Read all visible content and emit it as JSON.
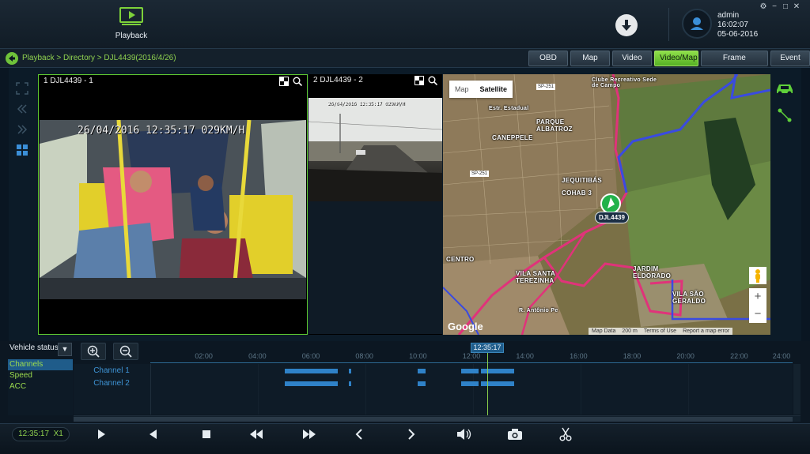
{
  "app": {
    "module_label": "Playback",
    "user": {
      "name": "admin",
      "time": "16:02:07",
      "date": "05-06-2016"
    },
    "window_controls": [
      "⚙",
      "−",
      "□",
      "✕"
    ]
  },
  "breadcrumb": "Playback > Directory > DJL4439(2016/4/26)",
  "view_tabs": [
    "OBD",
    "Map",
    "Video",
    "Video/Map",
    "Frame Information",
    "Event"
  ],
  "active_view_tab": "Video/Map",
  "panes": [
    {
      "title": "1 DJL4439 - 1",
      "osd": "26/04/2016 12:35:17  029KM/H"
    },
    {
      "title": "2 DJL4439 - 2",
      "osd": "26/04/2016 12:35:17  029KM/H"
    }
  ],
  "map": {
    "type_options": [
      "Map",
      "Satellite"
    ],
    "active_type": "Satellite",
    "vehicle_label": "DJL4439",
    "place_labels": [
      "PARQUE ALBATROZ",
      "CANEPPELE",
      "JEQUITIBÁS",
      "COHAB 3",
      "CENTRO",
      "VILA SANTA TEREZINHA",
      "JARDIM ELDORADO",
      "VILA SÃO GERALDO",
      "Clube Recreativo Sede de Campo",
      "Estr. Estadual",
      "R. Antônio Pe"
    ],
    "road_chips": [
      "SP-251",
      "SP-251"
    ],
    "footer": [
      "Map Data",
      "200 m",
      "Terms of Use",
      "Report a map error"
    ],
    "google_logo": "Google",
    "zoom_in": "+",
    "zoom_out": "−",
    "route_color": "#e0337a",
    "track_color": "#3a4be0"
  },
  "timeline": {
    "vehicle_status_label": "Vehicle status",
    "left_items": [
      "Channels",
      "Speed",
      "ACC"
    ],
    "active_left_item": "Channels",
    "cursor_time": "12:35:17",
    "ticks": [
      "02:00",
      "04:00",
      "06:00",
      "08:00",
      "10:00",
      "12:00",
      "14:00",
      "16:00",
      "18:00",
      "20:00",
      "22:00",
      "24:00"
    ],
    "tracks": [
      {
        "label": "Channel 1"
      },
      {
        "label": "Channel 2"
      }
    ]
  },
  "controls": {
    "time": "12:35:17",
    "speed": "X1"
  },
  "colors": {
    "accent_green": "#8fd14f",
    "accent_blue": "#2f82c8"
  }
}
